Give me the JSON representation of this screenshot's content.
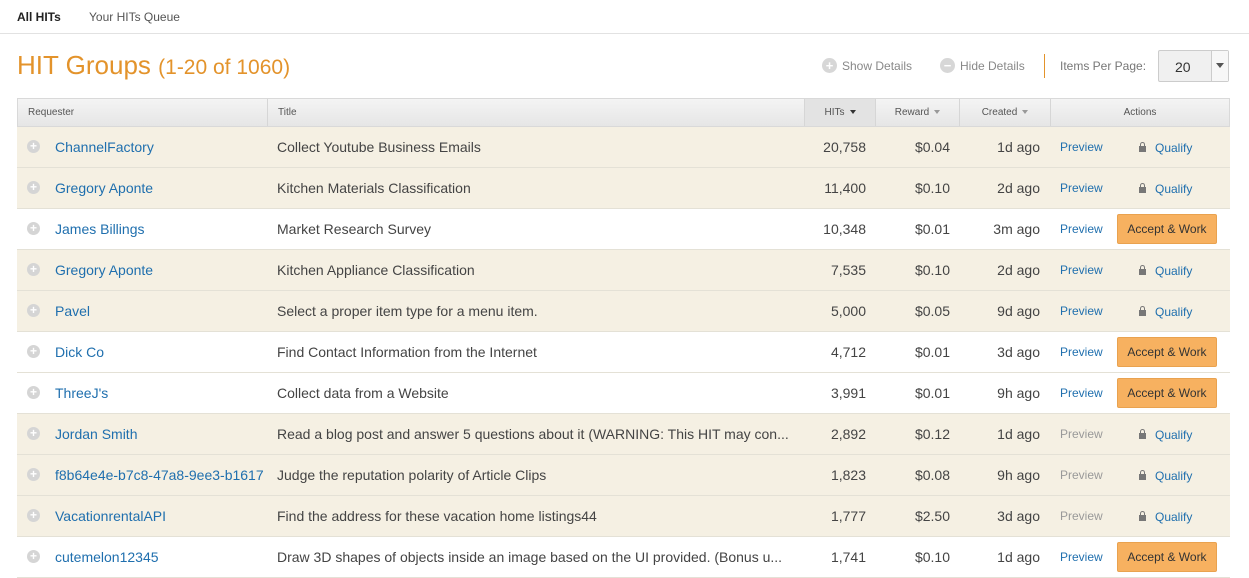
{
  "tabs": {
    "all_hits": "All HITs",
    "queue": "Your HITs Queue"
  },
  "heading": {
    "title": "HIT Groups",
    "count": "(1-20 of 1060)"
  },
  "controls": {
    "show_details": "Show Details",
    "hide_details": "Hide Details",
    "items_per_page_label": "Items Per Page:",
    "items_per_page_value": "20"
  },
  "columns": {
    "requester": "Requester",
    "title": "Title",
    "hits": "HITs",
    "reward": "Reward",
    "created": "Created",
    "actions": "Actions"
  },
  "action_labels": {
    "preview": "Preview",
    "qualify": "Qualify",
    "accept": "Accept & Work"
  },
  "rows": [
    {
      "requester": "ChannelFactory",
      "title": "Collect Youtube Business Emails",
      "hits": "20,758",
      "reward": "$0.04",
      "created": "1d ago",
      "action": "qualify",
      "preview_enabled": true
    },
    {
      "requester": "Gregory Aponte",
      "title": "Kitchen Materials Classification",
      "hits": "11,400",
      "reward": "$0.10",
      "created": "2d ago",
      "action": "qualify",
      "preview_enabled": true
    },
    {
      "requester": "James Billings",
      "title": "Market Research Survey",
      "hits": "10,348",
      "reward": "$0.01",
      "created": "3m ago",
      "action": "accept",
      "preview_enabled": true
    },
    {
      "requester": "Gregory Aponte",
      "title": "Kitchen Appliance Classification",
      "hits": "7,535",
      "reward": "$0.10",
      "created": "2d ago",
      "action": "qualify",
      "preview_enabled": true
    },
    {
      "requester": "Pavel",
      "title": "Select a proper item type for a menu item.",
      "hits": "5,000",
      "reward": "$0.05",
      "created": "9d ago",
      "action": "qualify",
      "preview_enabled": true
    },
    {
      "requester": "Dick Co",
      "title": "Find Contact Information from the Internet",
      "hits": "4,712",
      "reward": "$0.01",
      "created": "3d ago",
      "action": "accept",
      "preview_enabled": true
    },
    {
      "requester": "ThreeJ's",
      "title": "Collect data from a Website",
      "hits": "3,991",
      "reward": "$0.01",
      "created": "9h ago",
      "action": "accept",
      "preview_enabled": true
    },
    {
      "requester": "Jordan Smith",
      "title": "Read a blog post and answer 5 questions about it (WARNING: This HIT may con...",
      "hits": "2,892",
      "reward": "$0.12",
      "created": "1d ago",
      "action": "qualify",
      "preview_enabled": false
    },
    {
      "requester": "f8b64e4e-b7c8-47a8-9ee3-b1617",
      "title": "Judge the reputation polarity of Article Clips",
      "hits": "1,823",
      "reward": "$0.08",
      "created": "9h ago",
      "action": "qualify",
      "preview_enabled": false
    },
    {
      "requester": "VacationrentalAPI",
      "title": "Find the address for these vacation home listings44",
      "hits": "1,777",
      "reward": "$2.50",
      "created": "3d ago",
      "action": "qualify",
      "preview_enabled": false
    },
    {
      "requester": "cutemelon12345",
      "title": "Draw 3D shapes of objects inside an image based on the UI provided. (Bonus u...",
      "hits": "1,741",
      "reward": "$0.10",
      "created": "1d ago",
      "action": "accept",
      "preview_enabled": true
    }
  ]
}
